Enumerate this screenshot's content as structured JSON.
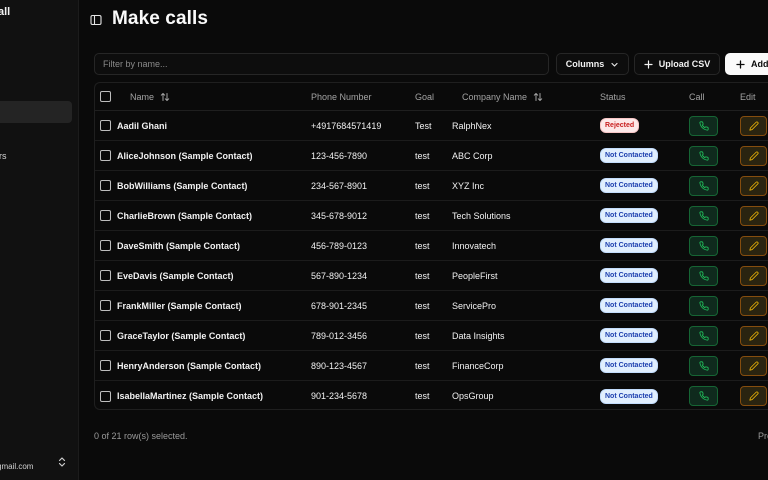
{
  "sidebar": {
    "top_label": "all",
    "item_label": "rs",
    "user_email": "gmail.com"
  },
  "header": {
    "title": "Make calls"
  },
  "toolbar": {
    "filter_placeholder": "Filter by name...",
    "columns_label": "Columns",
    "upload_label": "Upload CSV",
    "add_label": "Add"
  },
  "table": {
    "headers": {
      "name": "Name",
      "phone": "Phone Number",
      "goal": "Goal",
      "company": "Company Name",
      "status": "Status",
      "call": "Call",
      "edit": "Edit"
    },
    "rows": [
      {
        "name": "Aadil Ghani",
        "phone": "+4917684571419",
        "goal": "Test",
        "company": "RalphNex",
        "status": "Rejected"
      },
      {
        "name": "AliceJohnson (Sample Contact)",
        "phone": "123-456-7890",
        "goal": "test",
        "company": "ABC Corp",
        "status": "Not Contacted"
      },
      {
        "name": "BobWilliams (Sample Contact)",
        "phone": "234-567-8901",
        "goal": "test",
        "company": "XYZ Inc",
        "status": "Not Contacted"
      },
      {
        "name": "CharlieBrown (Sample Contact)",
        "phone": "345-678-9012",
        "goal": "test",
        "company": "Tech Solutions",
        "status": "Not Contacted"
      },
      {
        "name": "DaveSmith (Sample Contact)",
        "phone": "456-789-0123",
        "goal": "test",
        "company": "Innovatech",
        "status": "Not Contacted"
      },
      {
        "name": "EveDavis (Sample Contact)",
        "phone": "567-890-1234",
        "goal": "test",
        "company": "PeopleFirst",
        "status": "Not Contacted"
      },
      {
        "name": "FrankMiller (Sample Contact)",
        "phone": "678-901-2345",
        "goal": "test",
        "company": "ServicePro",
        "status": "Not Contacted"
      },
      {
        "name": "GraceTaylor (Sample Contact)",
        "phone": "789-012-3456",
        "goal": "test",
        "company": "Data Insights",
        "status": "Not Contacted"
      },
      {
        "name": "HenryAnderson (Sample Contact)",
        "phone": "890-123-4567",
        "goal": "test",
        "company": "FinanceCorp",
        "status": "Not Contacted"
      },
      {
        "name": "IsabellaMartinez (Sample Contact)",
        "phone": "901-234-5678",
        "goal": "test",
        "company": "OpsGroup",
        "status": "Not Contacted"
      }
    ]
  },
  "footer": {
    "selection_text": "0 of 21 row(s) selected.",
    "prev_label": "Pre"
  },
  "colors": {
    "background": "#0a0a0a",
    "sidebar": "#111111",
    "call_accent": "#22c55e",
    "edit_accent": "#eab308",
    "rejected": "#c81e1e",
    "not_contacted": "#1e40af"
  }
}
